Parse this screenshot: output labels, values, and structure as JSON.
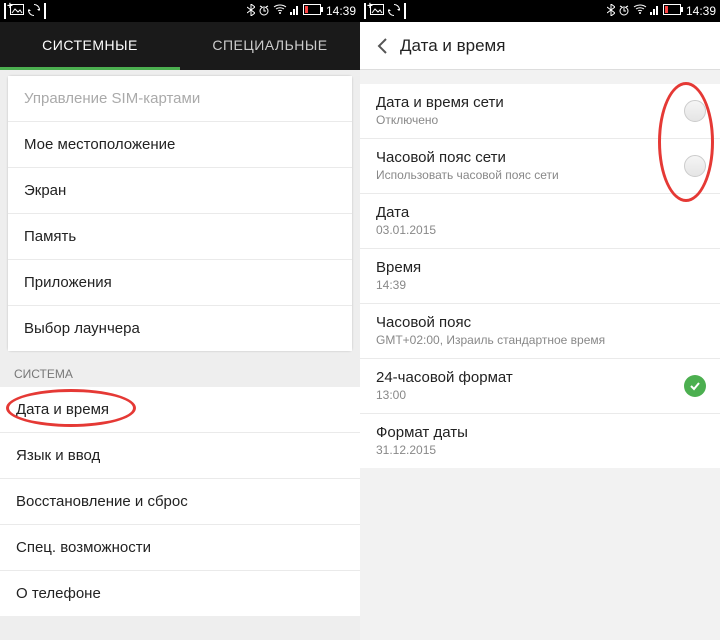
{
  "status": {
    "time": "14:39",
    "icons_left": [
      "plus-box",
      "image",
      "refresh",
      "box"
    ],
    "icons_right": [
      "bluetooth",
      "alarm",
      "wifi",
      "signal",
      "battery"
    ]
  },
  "left": {
    "tabs": {
      "system": "СИСТЕМНЫЕ",
      "special": "СПЕЦИАЛЬНЫЕ"
    },
    "items1": {
      "sim": "Управление SIM-картами",
      "location": "Мое местоположение",
      "display": "Экран",
      "memory": "Память",
      "apps": "Приложения",
      "launcher": "Выбор лаунчера"
    },
    "section": "СИСТЕМА",
    "items2": {
      "datetime": "Дата и время",
      "lang": "Язык и ввод",
      "reset": "Восстановление и сброс",
      "access": "Спец. возможности",
      "about": "О телефоне"
    }
  },
  "right": {
    "title": "Дата и время",
    "r1": {
      "t": "Дата и время сети",
      "s": "Отключено"
    },
    "r2": {
      "t": "Часовой пояс сети",
      "s": "Использовать часовой пояс сети"
    },
    "r3": {
      "t": "Дата",
      "s": "03.01.2015"
    },
    "r4": {
      "t": "Время",
      "s": "14:39"
    },
    "r5": {
      "t": "Часовой пояс",
      "s": "GMT+02:00, Израиль стандартное время"
    },
    "r6": {
      "t": "24-часовой формат",
      "s": "13:00"
    },
    "r7": {
      "t": "Формат даты",
      "s": "31.12.2015"
    }
  }
}
